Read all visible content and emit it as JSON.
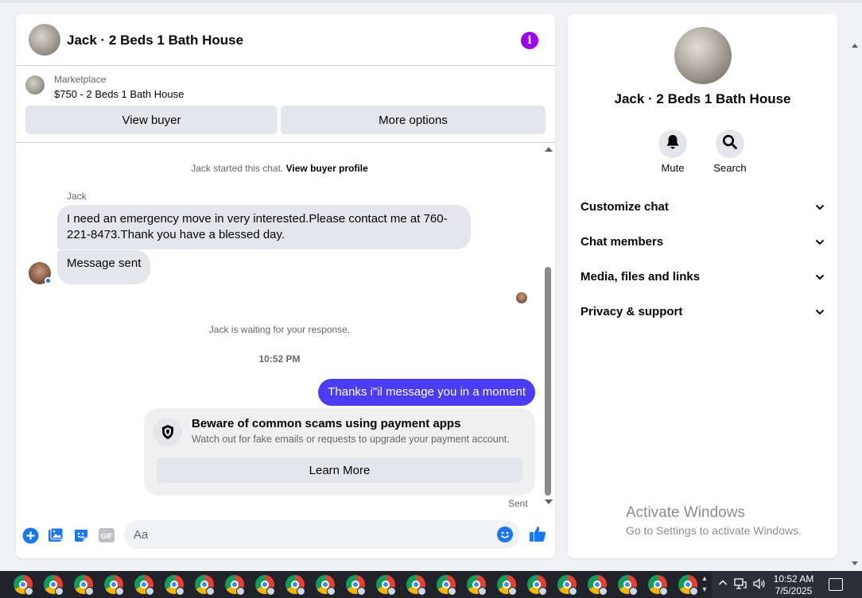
{
  "chat": {
    "title": "Jack · 2 Beds 1 Bath House",
    "marketplace_label": "Marketplace",
    "listing": "$750 - 2 Beds 1 Bath House",
    "view_buyer_label": "View buyer",
    "more_options_label": "More options",
    "started_text": "Jack started this chat.",
    "view_profile_link": "View buyer profile",
    "sender_name": "Jack",
    "incoming_message_1": "I need an emergency move in very interested.Please  contact me at 760-221-8473.Thank you have a blessed day.",
    "incoming_message_2": "Message sent",
    "waiting_text": "Jack is waiting for your response.",
    "timestamp": "10:52 PM",
    "outgoing_message": "Thanks i\"il message you in a moment",
    "warning": {
      "title": "Beware of common scams using payment apps",
      "subtitle": "Watch out for fake emails or requests to upgrade your payment account.",
      "button": "Learn More"
    },
    "sent_status": "Sent",
    "composer_placeholder": "Aa",
    "accent_color": "#4a3df5",
    "icons": [
      "plus-icon",
      "image-icon",
      "sticker-icon",
      "gif-icon",
      "emoji-icon",
      "thumbs-up-icon"
    ],
    "gif_label": "GIF"
  },
  "info_panel": {
    "name": "Jack · 2 Beds 1 Bath House",
    "mute_label": "Mute",
    "search_label": "Search",
    "sections": [
      "Customize chat",
      "Chat members",
      "Media, files and links",
      "Privacy & support"
    ]
  },
  "watermark": {
    "title": "Activate Windows",
    "subtitle": "Go to Settings to activate Windows."
  },
  "taskbar": {
    "time": "10:52 AM",
    "date": "7/5/2025"
  }
}
